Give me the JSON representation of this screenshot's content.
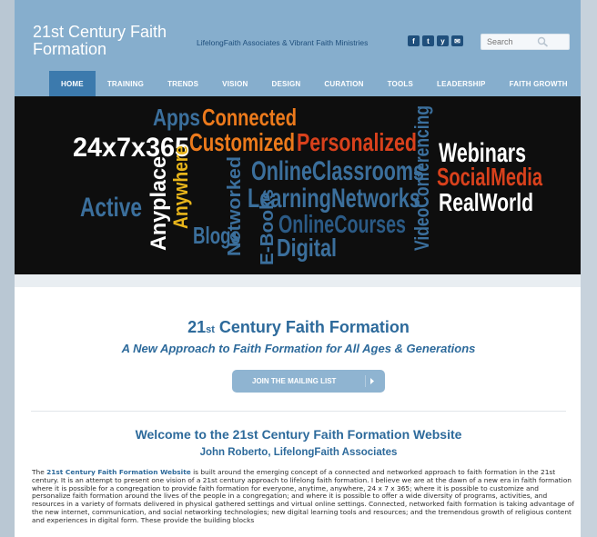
{
  "header": {
    "site_title": "21st Century Faith Formation",
    "tagline": "LifelongFaith Associates & Vibrant Faith Ministries",
    "social": [
      "f",
      "t",
      "y",
      "✉"
    ],
    "search_placeholder": "Search"
  },
  "nav": {
    "items": [
      "HOME",
      "TRAINING",
      "TRENDS",
      "VISION",
      "DESIGN",
      "CURATION",
      "TOOLS",
      "LEADERSHIP",
      "FAITH GROWTH"
    ],
    "active": "HOME"
  },
  "banner": {
    "words": {
      "apps": "Apps",
      "connected": "Connected",
      "customized": "Customized",
      "personalized": "Personalized",
      "twentyfour": "24x7x365",
      "video": "VideoConferencing",
      "webinars": "Webinars",
      "socialmedia": "SocialMedia",
      "realworld": "RealWorld",
      "onlineclassrooms": "OnlineClassrooms",
      "learningnetworks": "LearningNetworks",
      "onlinecourses": "OnlineCourses",
      "digital": "Digital",
      "active": "Active",
      "anyplace": "Anyplace",
      "anywhere": "Anywhere",
      "networked": "Networked",
      "ebooks": "E-Books",
      "blogs": "Blogs"
    },
    "colors": {
      "blue": "#3b6f9c",
      "orange": "#ec7a1c",
      "yellow": "#e8b51b",
      "white": "#ffffff",
      "red": "#d9411c",
      "darkblue": "#2b5a85"
    }
  },
  "main": {
    "title_prefix": "21",
    "title_suffix": "st",
    "title_rest": " Century Faith Formation",
    "subtitle": "A New Approach to Faith Formation for All Ages & Generations",
    "mailing_button": "JOIN THE MAILING LIST",
    "welcome": "Welcome to the 21st Century Faith Formation Website",
    "author": "John Roberto, LifelongFaith Associates",
    "body_pre": "The ",
    "body_link": "21st Century Faith Formation Website",
    "body_text": " is built around the emerging concept of a connected and networked approach to faith formation in the 21st century. It is an attempt to present one vision of a 21st century approach to lifelong faith formation. I believe we are at the dawn of a new era in faith formation where it is possible for a congregation to provide faith formation for everyone, anytime, anywhere, 24 x 7 x 365; where it is possible to customize and personalize faith formation around the lives of the people in a congregation; and where it is possible to offer a wide diversity of programs, activities, and resources in a variety of formats delivered in physical gathered settings and virtual online settings. Connected, networked faith formation is taking advantage of the new internet, communication, and social networking technologies; new digital learning tools and resources; and the tremendous growth of religious content and experiences in digital form. These provide the building blocks"
  }
}
